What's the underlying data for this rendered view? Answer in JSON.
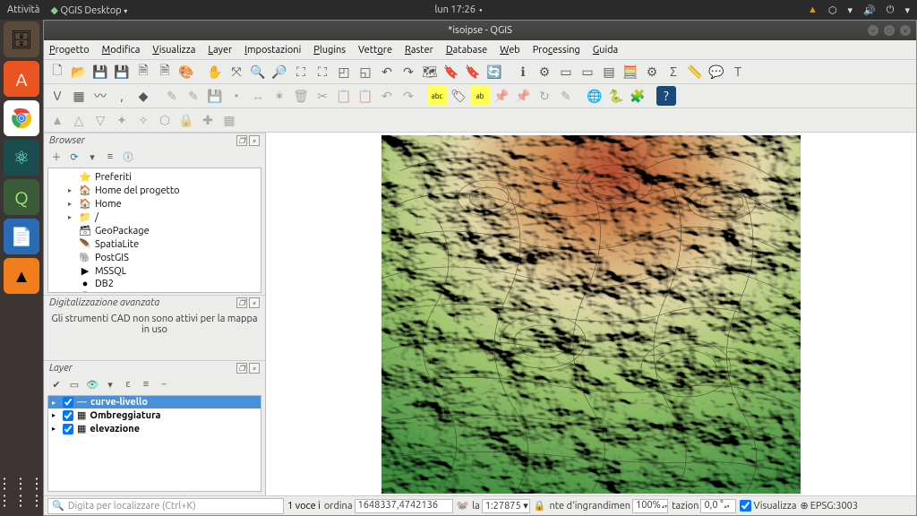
{
  "topbar": {
    "activities": "Attività",
    "app_menu": "QGIS Desktop",
    "clock": "lun 17:26",
    "tray_icons": [
      "vlc-icon",
      "dropbox-icon",
      "network-icon",
      "volume-icon",
      "power-icon",
      "settings-icon"
    ]
  },
  "launcher": [
    {
      "name": "files"
    },
    {
      "name": "software"
    },
    {
      "name": "chrome"
    },
    {
      "name": "atom"
    },
    {
      "name": "qgis"
    },
    {
      "name": "writer"
    },
    {
      "name": "vlc"
    }
  ],
  "window": {
    "title": "*isoipse - QGIS",
    "menus": [
      "Progetto",
      "Modifica",
      "Visualizza",
      "Layer",
      "Impostazioni",
      "Plugins",
      "Vettore",
      "Raster",
      "Database",
      "Web",
      "Processing",
      "Guida"
    ]
  },
  "browser": {
    "title": "Browser",
    "items": [
      {
        "icon": "⭐",
        "label": "Preferiti",
        "exp": ""
      },
      {
        "icon": "🏠",
        "label": "Home del progetto",
        "exp": "▸"
      },
      {
        "icon": "🏠",
        "label": "Home",
        "exp": "▸"
      },
      {
        "icon": "📁",
        "label": "/",
        "exp": "▸"
      },
      {
        "icon": "🗃",
        "label": "GeoPackage",
        "exp": ""
      },
      {
        "icon": "🪶",
        "label": "SpatiaLite",
        "exp": ""
      },
      {
        "icon": "🐘",
        "label": "PostGIS",
        "exp": ""
      },
      {
        "icon": "▶",
        "label": "MSSQL",
        "exp": ""
      },
      {
        "icon": "●",
        "label": "DB2",
        "exp": ""
      },
      {
        "icon": "🌐",
        "label": "WMS/WMTS",
        "exp": ""
      }
    ]
  },
  "cad": {
    "title": "Digitalizzazione avanzata",
    "message": "Gli strumenti CAD non sono attivi per la mappa in uso"
  },
  "layers": {
    "title": "Layer",
    "items": [
      {
        "label": "curve-livello",
        "sel": true,
        "sym": "—"
      },
      {
        "label": "Ombreggiatura",
        "sel": false,
        "sym": "▦"
      },
      {
        "label": "elevazione",
        "sel": false,
        "sym": "▦"
      }
    ]
  },
  "status": {
    "locator_placeholder": "Digita per localizzare (Ctrl+K)",
    "feature_count": "1 voce i",
    "coord_label": "ordina",
    "coord_value": "1648337,4742136",
    "scale_label": "la",
    "scale_value": "1:27875",
    "magnifier_label": "nte d'ingrandimen",
    "magnifier_value": "100%",
    "rotation_label": "tazion",
    "rotation_value": "0,0 °",
    "render_label": "Visualizza",
    "crs": "EPSG:3003"
  }
}
